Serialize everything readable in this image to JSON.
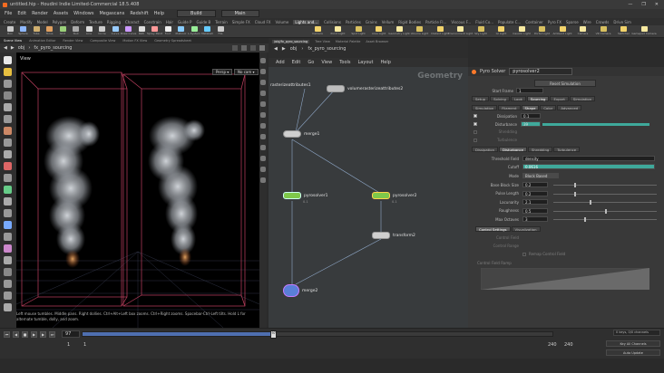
{
  "window": {
    "title": "untitled.hip - Houdini Indie Limited-Commercial 18.5.408",
    "controls": [
      "—",
      "❐",
      "✕"
    ]
  },
  "menubar": {
    "items": [
      "File",
      "Edit",
      "Render",
      "Assets",
      "Windows",
      "Megascans",
      "Redshift",
      "Help"
    ],
    "desktop_select": "Build",
    "main_select": "Main"
  },
  "shelf_tabs": [
    "Create",
    "Modify",
    "Model",
    "Polygon",
    "Deform",
    "Texture",
    "Rigging",
    "Charact",
    "Constrain",
    "Hair",
    "Guide P",
    "Guide B",
    "Terrain",
    "Simple FX",
    "Cloud FX",
    "Volume",
    "Lights and...",
    "Collisions",
    "Particles",
    "Grains",
    "Vellum",
    "Rigid Bodies",
    "Particle Fl...",
    "Viscous F...",
    "Fluid Co...",
    "Populate C...",
    "Container",
    "Pyro FX",
    "Sparse",
    "Wire",
    "Crowds",
    "Drive Sim"
  ],
  "shelf_tools_left": [
    "Box",
    "Sphere",
    "Tube",
    "Torus",
    "Grid",
    "Null",
    "Line",
    "Circle",
    "Curve",
    "Draw Curve",
    "Path",
    "Spray Paint",
    "Font",
    "Platonic",
    "L-System",
    "Metaball",
    "File"
  ],
  "shelf_tools_right": [
    "Camera",
    "Point Light",
    "Spot Light",
    "Area Light",
    "Geometry Light",
    "Volume Light",
    "Distant Light",
    "Environment Light",
    "Sky Light",
    "GI Light",
    "Caustic Light",
    "Portal Light",
    "Ambient Light",
    "Camera",
    "VR Camera",
    "Switcher",
    "Gamepad Camera"
  ],
  "pane_tabs": [
    "Scene View",
    "Animation Editor",
    "Render View",
    "Composite View",
    "Motion FX View",
    "Geometry Spreadsheet"
  ],
  "viewport": {
    "label": "View",
    "path": [
      "obj",
      "fx_pyro_sourcing"
    ],
    "persp_label": "Persp ▾",
    "cam_label": "No cam ▾",
    "message": "Left mouse tumbles. Middle pans. Right dollies. Ctrl+Alt+Left box zooms. Ctrl+Right zooms. Spacebar-Ctrl-Left tilts. Hold L for alternate tumble, dolly, and zoom."
  },
  "network": {
    "tabs": [
      "/obj/fx_pyro_sourcing",
      "Tree View",
      "Material Palette",
      "Asset Browser"
    ],
    "path": [
      "obj",
      "fx_pyro_sourcing"
    ],
    "menu": [
      "Add",
      "Edit",
      "Go",
      "View",
      "Tools",
      "Layout",
      "Help"
    ],
    "context_label": "Geometry",
    "nodes": {
      "rasterize1": {
        "name": "rasterizeattributes1"
      },
      "volrasterize2": {
        "name": "volumerasterizeattributes2"
      },
      "merge1": {
        "name": "merge1"
      },
      "pyrosolver1": {
        "name": "pyrosolver1",
        "sub": "0.1"
      },
      "pyrosolver2": {
        "name": "pyrosolver2",
        "sub": "0.1"
      },
      "transform2": {
        "name": "transform2"
      },
      "merge2": {
        "name": "merge2"
      }
    }
  },
  "params": {
    "node_type": "Pyro Solver",
    "node_name": "pyrosolver2",
    "reset_button": "Reset Simulation",
    "start_frame_label": "Start Frame",
    "start_frame_value": "1",
    "main_tabs": [
      "Setup",
      "Solving",
      "Look",
      "Sourcing",
      "Export",
      "Simulation"
    ],
    "sub_tabs": [
      "Simulation",
      "Filament",
      "Shape",
      "Color",
      "Advanced"
    ],
    "toggles": [
      {
        "label": "Dissipation",
        "value": "0.1",
        "checked": true
      },
      {
        "label": "Disturbance",
        "value": "39",
        "checked": true
      },
      {
        "label": "Shredding",
        "value": "",
        "checked": false
      },
      {
        "label": "Turbulence",
        "value": "",
        "checked": false
      }
    ],
    "shape_tabs": [
      "Dissipation",
      "Disturbance",
      "Shredding",
      "Turbulence"
    ],
    "threshold_label": "Threshold Field",
    "threshold_value": "density",
    "cutoff_label": "Cutoff",
    "cutoff_value": "0.0616",
    "mode_label": "Mode",
    "mode_value": "Block Based",
    "fields": [
      {
        "label": "Base Block Size",
        "value": "0.2",
        "fill": 0.2
      },
      {
        "label": "Pulse Length",
        "value": "0.2",
        "fill": 0.2
      },
      {
        "label": "Lacunarity",
        "value": "2.1",
        "fill": 0.35
      },
      {
        "label": "Roughness",
        "value": "0.5",
        "fill": 0.5
      },
      {
        "label": "Max Octaves",
        "value": "3",
        "fill": 0.3
      }
    ],
    "control_tabs": [
      "Control Settings",
      "Visualization"
    ],
    "control_field_label": "Control Field",
    "control_range_label": "Control Range",
    "remap_label": "Remap Control Field",
    "ramp_label": "Control Field Ramp"
  },
  "timeline": {
    "current_frame": "97",
    "range_start": "1",
    "range_start2": "1",
    "range_end": "240",
    "range_end2": "240",
    "keys_info": "0 keys, 0/0 channels",
    "key_all_button": "Key All Channels",
    "auto_update": "Auto Update",
    "progress": 0.4
  }
}
